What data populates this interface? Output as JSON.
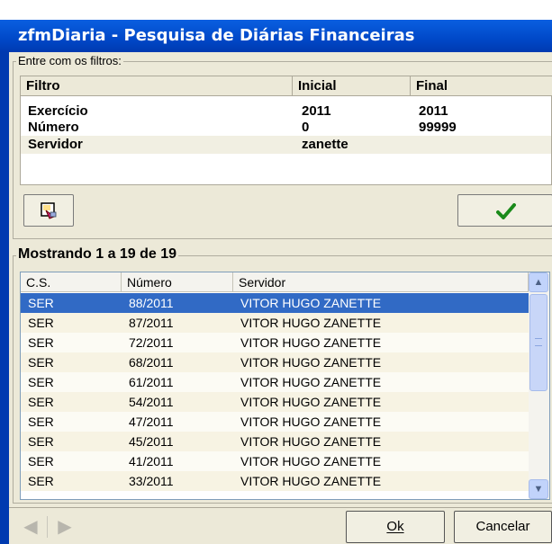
{
  "window": {
    "title": "zfmDiaria - Pesquisa de Diárias Financeiras"
  },
  "filters": {
    "group_label": "Entre com os filtros:",
    "columns": [
      "Filtro",
      "Inicial",
      "Final"
    ],
    "rows": [
      {
        "filtro": "Exercício",
        "inicial": "2011",
        "final": "2011"
      },
      {
        "filtro": "Número",
        "inicial": "0",
        "final": "99999"
      },
      {
        "filtro": "Servidor",
        "inicial": "zanette",
        "final": ""
      }
    ]
  },
  "toolbar": {
    "clear_icon": "eraser-icon",
    "apply_icon": "checkmark-icon"
  },
  "results": {
    "group_label": "Mostrando 1 a 19 de 19",
    "columns": [
      "C.S.",
      "Número",
      "Servidor"
    ],
    "rows": [
      {
        "cs": "SER",
        "numero": "88/2011",
        "servidor": "VITOR HUGO ZANETTE"
      },
      {
        "cs": "SER",
        "numero": "87/2011",
        "servidor": "VITOR HUGO ZANETTE"
      },
      {
        "cs": "SER",
        "numero": "72/2011",
        "servidor": "VITOR HUGO ZANETTE"
      },
      {
        "cs": "SER",
        "numero": "68/2011",
        "servidor": "VITOR HUGO ZANETTE"
      },
      {
        "cs": "SER",
        "numero": "61/2011",
        "servidor": "VITOR HUGO ZANETTE"
      },
      {
        "cs": "SER",
        "numero": "54/2011",
        "servidor": "VITOR HUGO ZANETTE"
      },
      {
        "cs": "SER",
        "numero": "47/2011",
        "servidor": "VITOR HUGO ZANETTE"
      },
      {
        "cs": "SER",
        "numero": "45/2011",
        "servidor": "VITOR HUGO ZANETTE"
      },
      {
        "cs": "SER",
        "numero": "41/2011",
        "servidor": "VITOR HUGO ZANETTE"
      },
      {
        "cs": "SER",
        "numero": "33/2011",
        "servidor": "VITOR HUGO ZANETTE"
      }
    ],
    "selected_index": 0
  },
  "footer": {
    "ok_label": "Ok",
    "cancel_label": "Cancelar"
  },
  "colors": {
    "title_bar": "#0048c8",
    "selection": "#316ac5",
    "face": "#ece9d8"
  }
}
